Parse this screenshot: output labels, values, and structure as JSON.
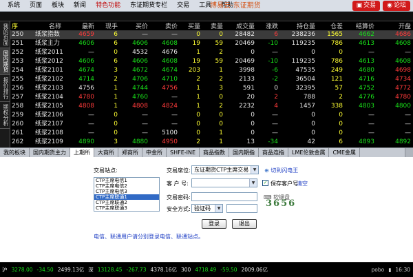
{
  "menubar": {
    "items": [
      {
        "label": "系统"
      },
      {
        "label": "页面"
      },
      {
        "label": "板块"
      },
      {
        "label": "新闻"
      },
      {
        "label": "特色功能"
      },
      {
        "label": "东证期货专栏"
      },
      {
        "label": "交易"
      },
      {
        "label": "工具"
      },
      {
        "label": "帮助"
      }
    ],
    "app_title": "博易云-东证期货",
    "trade_button": "交易",
    "forum_button": "论坛"
  },
  "side_tabs": [
    "我的页面",
    "国内期货",
    "报价排行",
    "期权分析"
  ],
  "quote_table": {
    "headers": [
      "序",
      "名称",
      "最新",
      "现手",
      "买价",
      "卖价",
      "买量",
      "卖量",
      "成交量",
      "涨跌",
      "持仓量",
      "仓差",
      "结算价",
      "开盘"
    ],
    "rows": [
      {
        "seq": "250",
        "name": "纸浆指数",
        "last": "4659",
        "vol_now": "6",
        "bid": "—",
        "ask": "—",
        "bid_qty": "0",
        "ask_qty": "0",
        "volume": "28482",
        "change": "6",
        "oi": "238236",
        "oi_diff": "1565",
        "settle": "4662",
        "open": "4686"
      },
      {
        "seq": "251",
        "name": "纸浆主力",
        "last": "4606",
        "vol_now": "6",
        "bid": "4606",
        "ask": "4608",
        "bid_qty": "19",
        "ask_qty": "59",
        "volume": "20469",
        "change": "-10",
        "oi": "119235",
        "oi_diff": "786",
        "settle": "4613",
        "open": "4608"
      },
      {
        "seq": "252",
        "name": "纸浆2011",
        "last": "—",
        "vol_now": "0",
        "bid": "4532",
        "ask": "4676",
        "bid_qty": "1",
        "ask_qty": "2",
        "volume": "0",
        "change": "—",
        "oi": "0",
        "oi_diff": "0",
        "settle": "—",
        "open": "—"
      },
      {
        "seq": "253",
        "name": "纸浆2012",
        "last": "4606",
        "vol_now": "6",
        "bid": "4606",
        "ask": "4608",
        "bid_qty": "19",
        "ask_qty": "59",
        "volume": "20469",
        "change": "-10",
        "oi": "119235",
        "oi_diff": "786",
        "settle": "4613",
        "open": "4608"
      },
      {
        "seq": "254",
        "name": "纸浆2101",
        "last": "4674",
        "vol_now": "3",
        "bid": "4672",
        "ask": "4674",
        "bid_qty": "203",
        "ask_qty": "1",
        "volume": "3998",
        "change": "-6",
        "oi": "47535",
        "oi_diff": "249",
        "settle": "4680",
        "open": "4698"
      },
      {
        "seq": "255",
        "name": "纸浆2102",
        "last": "4714",
        "vol_now": "2",
        "bid": "4706",
        "ask": "4710",
        "bid_qty": "2",
        "ask_qty": "2",
        "volume": "2133",
        "change": "-2",
        "oi": "36504",
        "oi_diff": "121",
        "settle": "4716",
        "open": "4734"
      },
      {
        "seq": "256",
        "name": "纸浆2103",
        "last": "4756",
        "vol_now": "1",
        "bid": "4744",
        "ask": "4756",
        "bid_qty": "1",
        "ask_qty": "3",
        "volume": "591",
        "change": "0",
        "oi": "32395",
        "oi_diff": "57",
        "settle": "4752",
        "open": "4772"
      },
      {
        "seq": "257",
        "name": "纸浆2104",
        "last": "4780",
        "vol_now": "1",
        "bid": "4760",
        "ask": "—",
        "bid_qty": "1",
        "ask_qty": "0",
        "volume": "20",
        "change": "2",
        "oi": "788",
        "oi_diff": "2",
        "settle": "4776",
        "open": "4780"
      },
      {
        "seq": "258",
        "name": "纸浆2105",
        "last": "4808",
        "vol_now": "1",
        "bid": "4808",
        "ask": "4824",
        "bid_qty": "1",
        "ask_qty": "2",
        "volume": "2232",
        "change": "4",
        "oi": "1457",
        "oi_diff": "338",
        "settle": "4803",
        "open": "4800"
      },
      {
        "seq": "259",
        "name": "纸浆2106",
        "last": "—",
        "vol_now": "0",
        "bid": "—",
        "ask": "—",
        "bid_qty": "0",
        "ask_qty": "0",
        "volume": "0",
        "change": "—",
        "oi": "0",
        "oi_diff": "0",
        "settle": "—",
        "open": "—"
      },
      {
        "seq": "260",
        "name": "纸浆2107",
        "last": "—",
        "vol_now": "0",
        "bid": "—",
        "ask": "—",
        "bid_qty": "0",
        "ask_qty": "0",
        "volume": "0",
        "change": "—",
        "oi": "0",
        "oi_diff": "0",
        "settle": "—",
        "open": "—"
      },
      {
        "seq": "261",
        "name": "纸浆2108",
        "last": "—",
        "vol_now": "0",
        "bid": "—",
        "ask": "5100",
        "bid_qty": "0",
        "ask_qty": "1",
        "volume": "0",
        "change": "—",
        "oi": "0",
        "oi_diff": "0",
        "settle": "—",
        "open": "—"
      },
      {
        "seq": "262",
        "name": "纸浆2109",
        "last": "4890",
        "vol_now": "3",
        "bid": "4880",
        "ask": "4950",
        "bid_qty": "2",
        "ask_qty": "1",
        "volume": "13",
        "change": "-34",
        "oi": "42",
        "oi_diff": "6",
        "settle": "4893",
        "open": "4892"
      }
    ]
  },
  "tabbar": {
    "tabs": [
      "我的板块",
      "国内期货主力",
      "上期所",
      "大商所",
      "郑商所",
      "中金所",
      "SHFE-INE",
      "商品指数",
      "国内期指",
      "商品连指",
      "LME伦敦金属",
      "CME金属"
    ],
    "active_index": 2
  },
  "login": {
    "site_label": "交易站点:",
    "sites": [
      "CTP主席电信1",
      "CTP主席电信2",
      "CTP主席电信3",
      "CTP主席联通1",
      "CTP主席联通2",
      "CTP主席联通3"
    ],
    "selected_site_index": 3,
    "seat_label": "交易席位:",
    "seat_value": "东证期货CTP主席交易",
    "switch_link": "切到闪电王",
    "account_label": "客 户 号:",
    "save_account_label": "保存客户号",
    "clear_link": "清空",
    "password_label": "交易密码:",
    "soft_keyboard": "软键盘",
    "security_label": "安全方式:",
    "security_value": "验证码",
    "captcha_text": "3656",
    "login_button": "登录",
    "exit_button": "退出",
    "notice": "电信、联通用户请分别登录电信、联通站点。"
  },
  "statusbar": {
    "segments": [
      {
        "text": "沪",
        "cls": "sb-white"
      },
      {
        "text": "3278.00",
        "cls": "sb-down"
      },
      {
        "text": "-34.50",
        "cls": "sb-down"
      },
      {
        "text": "2499.13亿",
        "cls": "sb-white"
      },
      {
        "text": "深",
        "cls": "sb-white"
      },
      {
        "text": "13128.45",
        "cls": "sb-down"
      },
      {
        "text": "-267.73",
        "cls": "sb-down"
      },
      {
        "text": "4378.16亿",
        "cls": "sb-white"
      },
      {
        "text": "300",
        "cls": "sb-white"
      },
      {
        "text": "4718.49",
        "cls": "sb-down"
      },
      {
        "text": "-59.50",
        "cls": "sb-down"
      },
      {
        "text": "2009.06亿",
        "cls": "sb-white"
      }
    ],
    "brand": "pobo",
    "time": "16:30"
  },
  "colors": {
    "up": "#ff3b3b",
    "down": "#19e01a",
    "selected_row": "#3b3b3b",
    "menubar": "#d9dee6",
    "accent_red": "#d11a1a"
  }
}
